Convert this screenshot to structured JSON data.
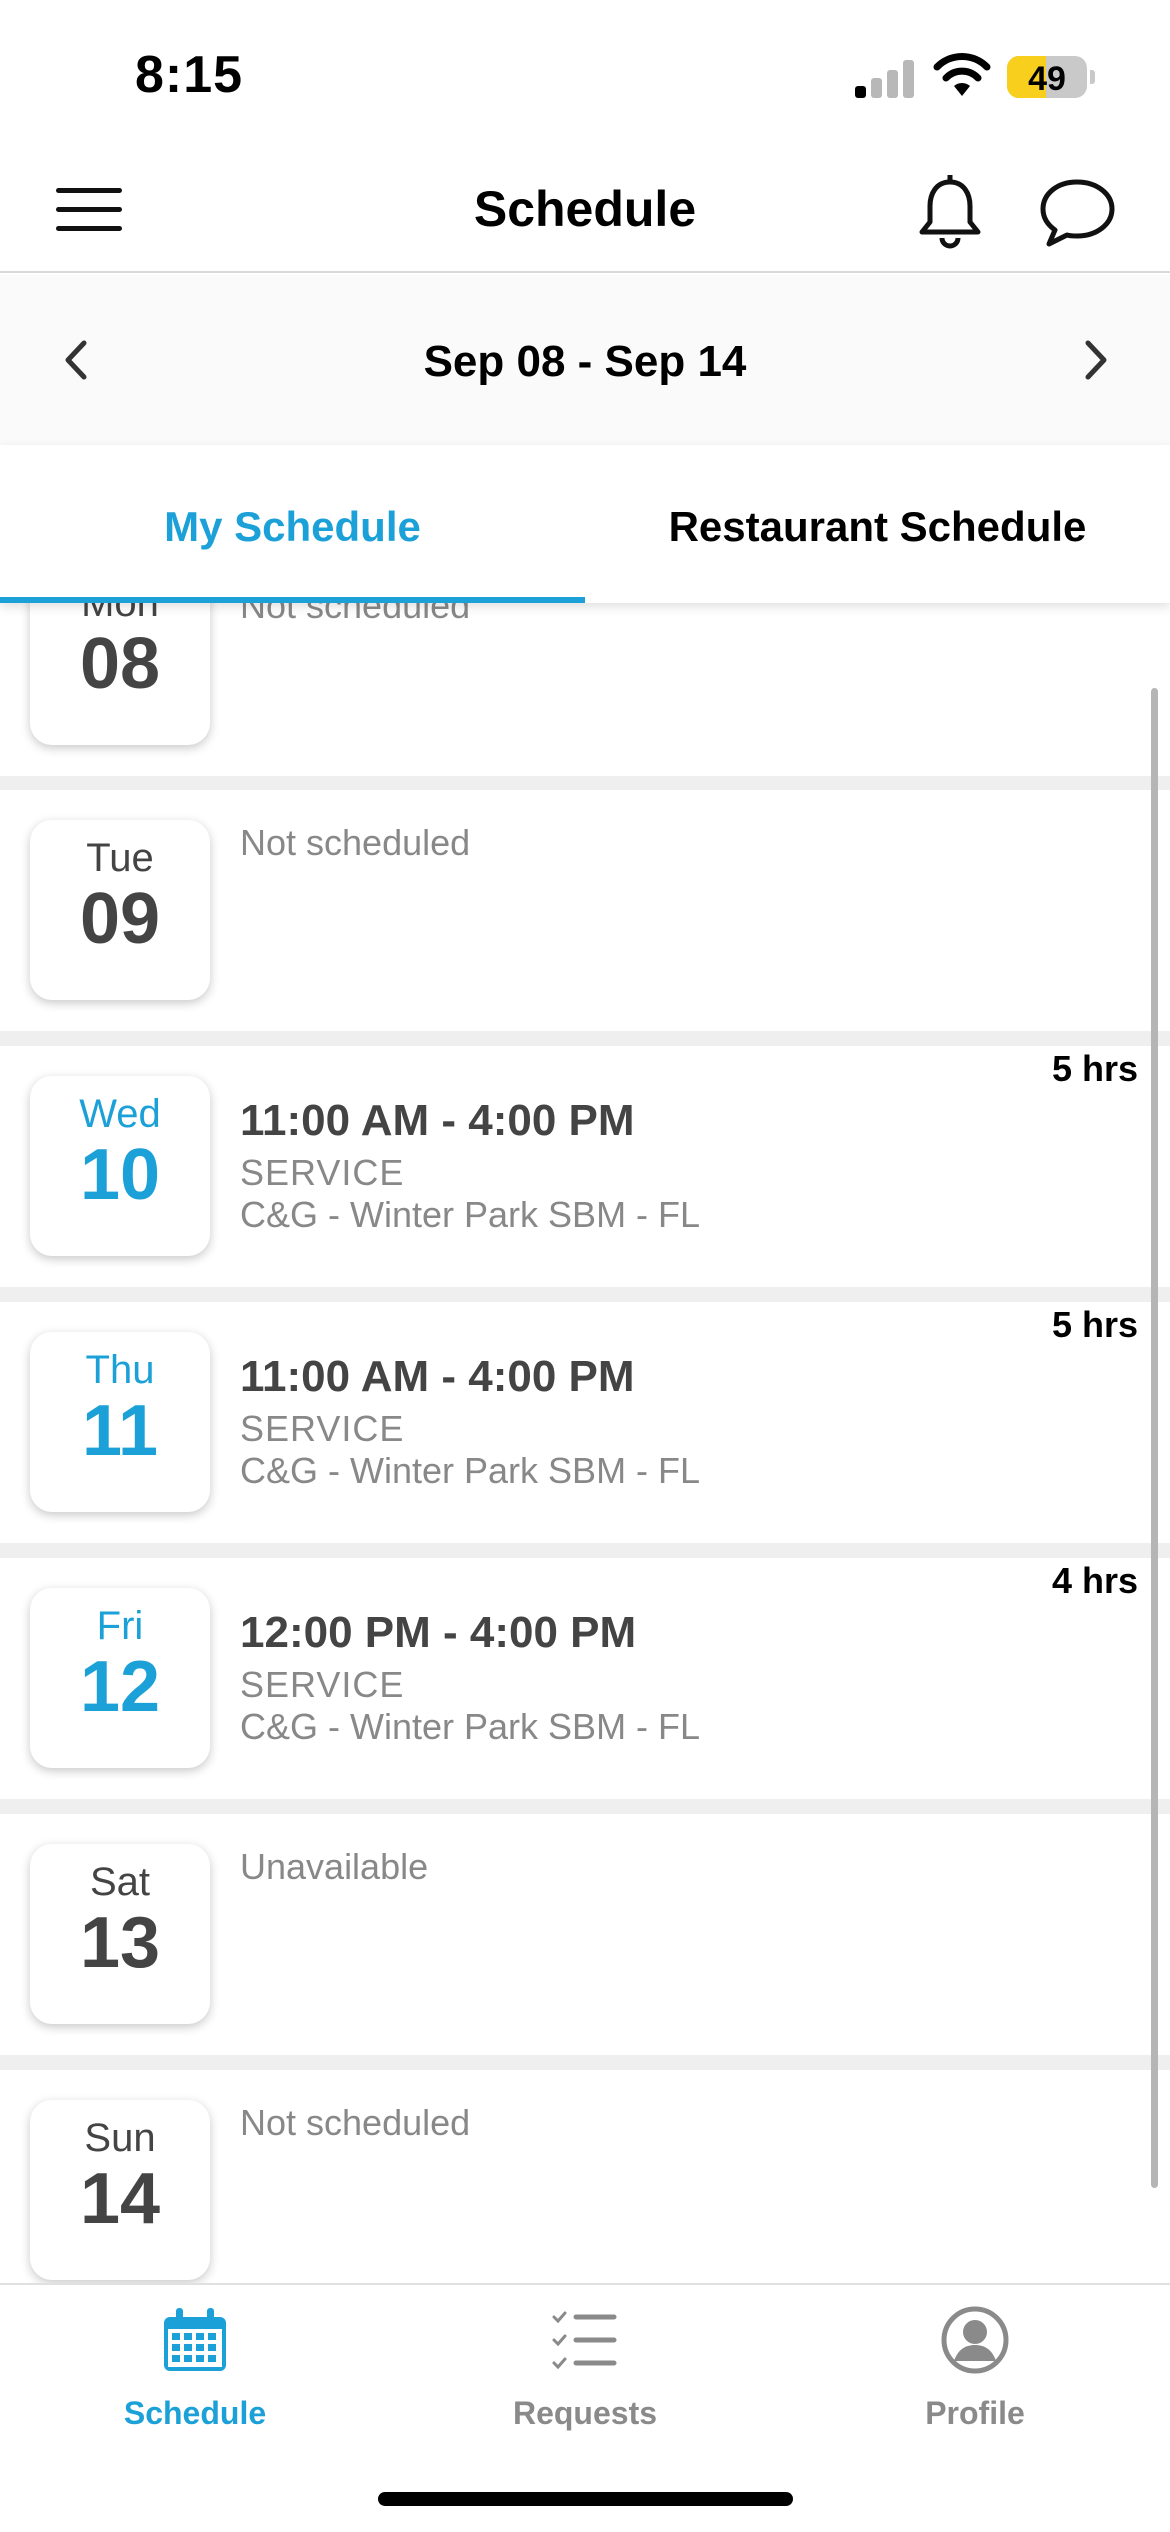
{
  "status_bar": {
    "time": "8:15",
    "battery_level": "49",
    "battery_fraction": 0.49
  },
  "header": {
    "title": "Schedule"
  },
  "week_nav": {
    "label": "Sep 08 - Sep 14"
  },
  "tabs": [
    {
      "label": "My Schedule",
      "active": true
    },
    {
      "label": "Restaurant Schedule",
      "active": false
    }
  ],
  "days": [
    {
      "dow": "Mon",
      "date": "08",
      "status": "Not scheduled"
    },
    {
      "dow": "Tue",
      "date": "09",
      "status": "Not scheduled"
    },
    {
      "dow": "Wed",
      "date": "10",
      "time": "11:00 AM - 4:00 PM",
      "role": "SERVICE",
      "location": "C&G - Winter Park SBM - FL",
      "hours": "5 hrs"
    },
    {
      "dow": "Thu",
      "date": "11",
      "time": "11:00 AM - 4:00 PM",
      "role": "SERVICE",
      "location": "C&G - Winter Park SBM - FL",
      "hours": "5 hrs"
    },
    {
      "dow": "Fri",
      "date": "12",
      "time": "12:00 PM - 4:00 PM",
      "role": "SERVICE",
      "location": "C&G - Winter Park SBM - FL",
      "hours": "4 hrs"
    },
    {
      "dow": "Sat",
      "date": "13",
      "status": "Unavailable"
    },
    {
      "dow": "Sun",
      "date": "14",
      "status": "Not scheduled"
    }
  ],
  "bottom_nav": [
    {
      "label": "Schedule",
      "icon": "calendar-icon",
      "active": true
    },
    {
      "label": "Requests",
      "icon": "checklist-icon",
      "active": false
    },
    {
      "label": "Profile",
      "icon": "profile-icon",
      "active": false
    }
  ],
  "colors": {
    "accent": "#1ba0d8",
    "battery": "#f7cf1c"
  }
}
